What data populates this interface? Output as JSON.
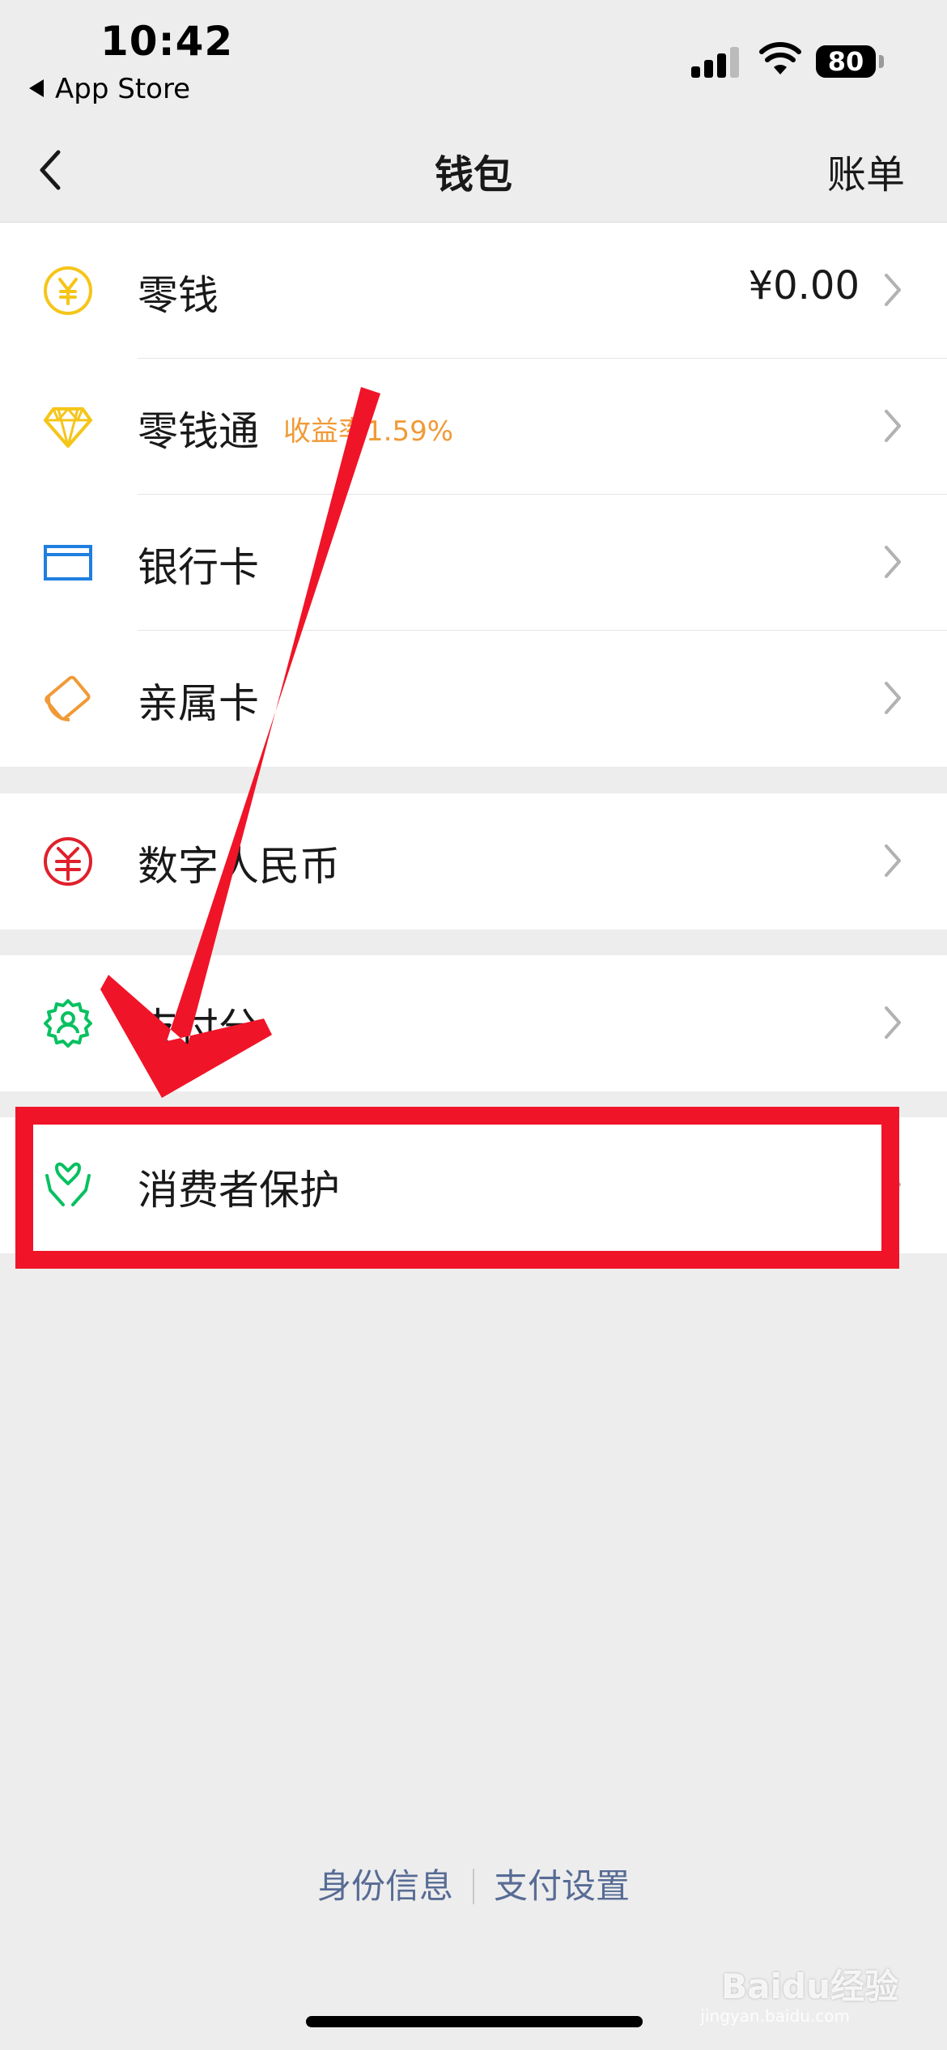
{
  "status_bar": {
    "time": "10:42",
    "back_app": "App Store",
    "battery": "80"
  },
  "nav": {
    "title": "钱包",
    "right_action": "账单"
  },
  "group1": [
    {
      "label": "零钱",
      "value": "¥0.00",
      "icon": "yuan-coin-icon",
      "icon_color": "#f5c518"
    },
    {
      "label": "零钱通",
      "promo": "收益率1.59%",
      "icon": "diamond-icon",
      "icon_color": "#f5c518"
    },
    {
      "label": "银行卡",
      "icon": "bank-card-icon",
      "icon_color": "#1f7fe0"
    },
    {
      "label": "亲属卡",
      "icon": "family-card-icon",
      "icon_color": "#f09a37"
    }
  ],
  "group2": [
    {
      "label": "数字人民币",
      "icon": "digital-rmb-icon",
      "icon_color": "#e0202b"
    }
  ],
  "group3": [
    {
      "label": "支付分",
      "icon": "pay-score-icon",
      "icon_color": "#07c160"
    }
  ],
  "group4": [
    {
      "label": "消费者保护",
      "icon": "consumer-protection-icon",
      "icon_color": "#07c160"
    }
  ],
  "footer": {
    "identity": "身份信息",
    "pay_settings": "支付设置"
  },
  "annotation": {
    "arrow_color": "#f01428",
    "highlight_color": "#f01428"
  },
  "watermark": {
    "brand": "Baidu经验",
    "url": "jingyan.baidu.com"
  }
}
